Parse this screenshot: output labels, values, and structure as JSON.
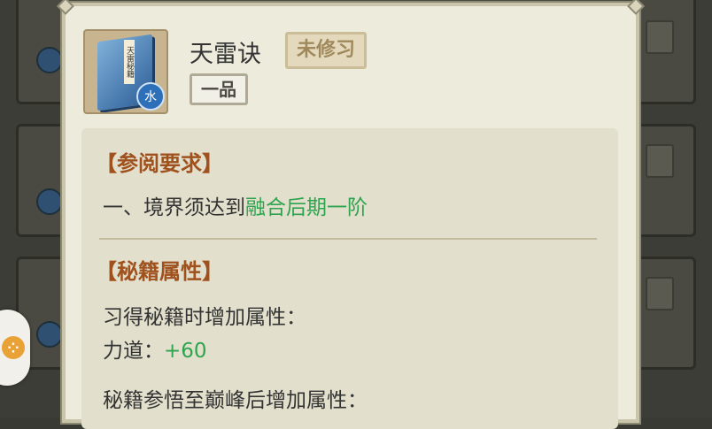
{
  "skill": {
    "name": "天雷诀",
    "status": "未修习",
    "grade": "一品",
    "element": "水",
    "book_title": "天雷秘籍"
  },
  "requirements": {
    "title": "【参阅要求】",
    "line_prefix": "一、境界须达到",
    "line_value": "融合后期一阶"
  },
  "attributes": {
    "title": "【秘籍属性】",
    "learn_label": "习得秘籍时增加属性：",
    "stat_name": "力道：",
    "stat_value": "+60",
    "peak_label": "秘籍参悟至巅峰后增加属性："
  },
  "colors": {
    "section_title": "#a0521e",
    "highlight_green": "#2ea44f"
  },
  "icons": [
    "book-icon",
    "water-element-icon",
    "floating-menu-icon"
  ]
}
